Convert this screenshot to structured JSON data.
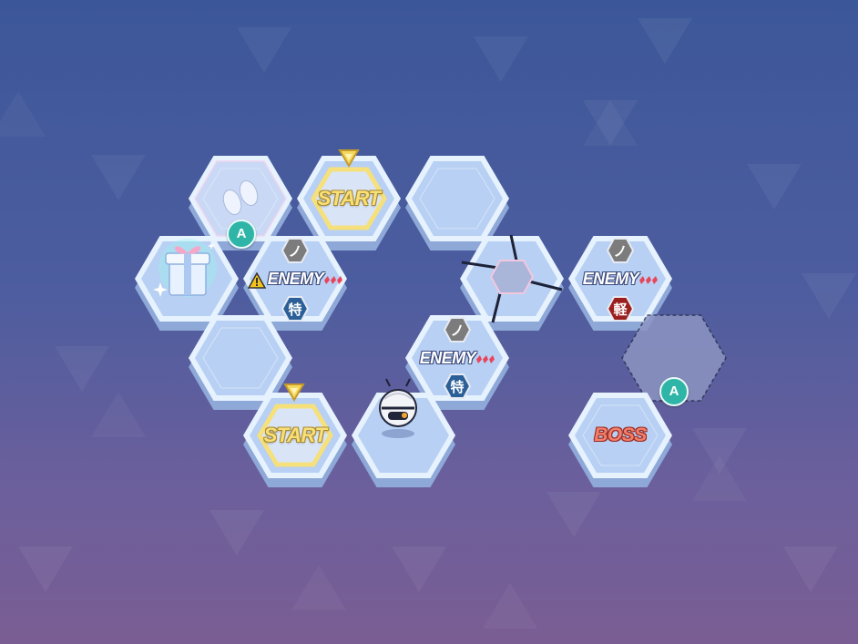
{
  "tiles": {
    "start_top": {
      "label": "START"
    },
    "start_bottom": {
      "label": "START"
    },
    "enemy_1": {
      "label": "ENEMY",
      "top_glyph": "ノ",
      "bottom_glyph": "特"
    },
    "enemy_2": {
      "label": "ENEMY",
      "top_glyph": "ノ",
      "bottom_glyph": "特"
    },
    "enemy_3": {
      "label": "ENEMY",
      "top_glyph": "ノ",
      "bottom_glyph": "軽"
    },
    "boss": {
      "label": "BOSS"
    }
  },
  "markers": {
    "a_left": "A",
    "a_right": "A"
  },
  "colors": {
    "tile_face": "#b9d4f5",
    "tile_border": "#e6f3ff",
    "start_accent": "#f5e07c",
    "boss_text": "#f07f6c",
    "badge_gray": "#7c7c7c",
    "badge_blue": "#2a5f97",
    "badge_red": "#9b1e1e",
    "marker_teal": "#2fb5a7"
  },
  "icons": [
    "footprints-icon",
    "gift-box-icon",
    "robot-unit-icon",
    "warning-icon",
    "start-arrow-icon"
  ]
}
